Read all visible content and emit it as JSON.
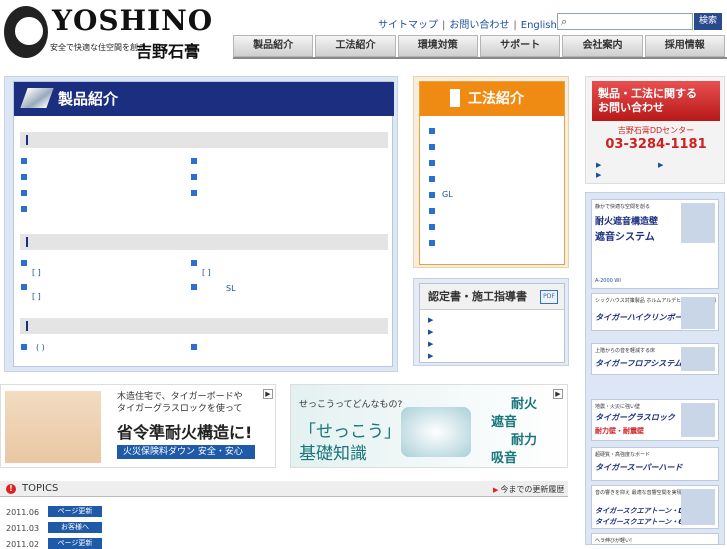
{
  "header": {
    "logo_text": "YOSHINO",
    "logo_tagline": "安全で快適な住空間を創る",
    "logo_jp": "吉野石膏",
    "utility": [
      "サイトマップ",
      "お問い合わせ",
      "English"
    ],
    "search_button": "検索",
    "nav": [
      "製品紹介",
      "工法紹介",
      "環境対策",
      "サポート",
      "会社案内",
      "採用情報"
    ]
  },
  "product": {
    "title": "製品紹介",
    "sec2_labels": [
      "[ ]",
      "[ ]",
      "[ ]",
      "SL"
    ],
    "sec3_labels": [
      "( )"
    ]
  },
  "construction": {
    "title": "工法紹介",
    "gl_label": "GL"
  },
  "cert": {
    "title": "認定書・施工指導書",
    "pdf": "PDF"
  },
  "contact": {
    "line1": "製品・工法に関する",
    "line2": "お問い合わせ",
    "center": "吉野石膏DDセンター",
    "tel": "03-3284-1181"
  },
  "side_ads": [
    {
      "small": "静かで快適な空間を創る",
      "big": "耐火遮音構造壁",
      "big2": "遮音システム",
      "note": "A-2000 WI"
    },
    {
      "small": "シックハウス対策製品 ホルムアルデヒドを吸収・分解",
      "big": "タイガーハイクリンボード",
      "big2": "",
      "note": ""
    },
    {
      "small": "上階からの音を軽減する床",
      "big": "タイガーフロアシステム",
      "big2": "",
      "note": ""
    },
    {
      "small": "地震・火災に強い壁",
      "big": "タイガーグラスロック",
      "big2": "耐力壁・耐震壁",
      "note": ""
    },
    {
      "small": "超硬質・高強度なボード",
      "big": "タイガースーパーハード",
      "big2": "",
      "note": ""
    },
    {
      "small": "音の響きを抑え 最適な音響空間を実現",
      "big": "タイガースクエアトーン・D",
      "big2": "タイガースクエアトーン・6",
      "note": ""
    },
    {
      "small": "ヘラ伸びが軽い!",
      "big": "",
      "big2": "",
      "note": ""
    }
  ],
  "banner1": {
    "line1": "木造住宅で、タイガーボードや",
    "line2": "タイガーグラスロックを使って",
    "headline": "省令準耐火構造に!",
    "sub": "火災保険料ダウン 安全・安心"
  },
  "banner2": {
    "question": "せっこうってどんなもの?",
    "line1": "「せっこう」",
    "line2": "基礎知識",
    "p1": "耐火",
    "p2": "遮音",
    "p3": "耐力",
    "p4": "吸音"
  },
  "topics": {
    "title": "TOPICS",
    "history": "今までの更新履歴",
    "items": [
      {
        "date": "2011.06",
        "tag": "ページ更新"
      },
      {
        "date": "2011.03",
        "tag": "お客様へ"
      },
      {
        "date": "2011.02",
        "tag": "ページ更新"
      }
    ]
  },
  "colors": {
    "navy": "#1c2e80",
    "orange": "#ef8a12",
    "red": "#c22",
    "link": "#1a4f9c"
  }
}
